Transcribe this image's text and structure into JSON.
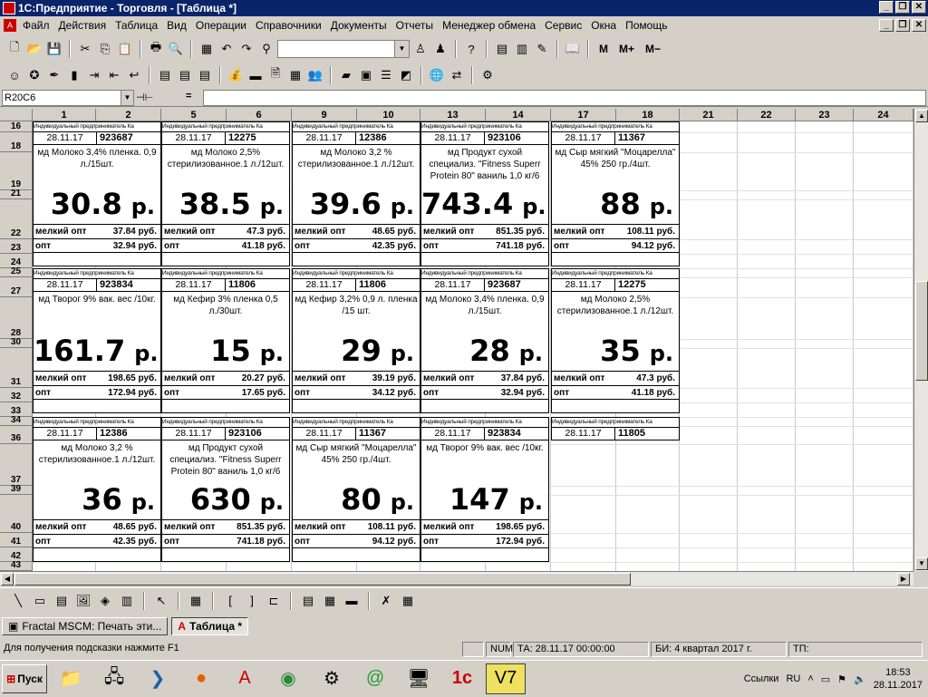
{
  "window": {
    "title": "1С:Предприятие - Торговля - [Таблица *]",
    "min": "_",
    "max": "❐",
    "close": "✕"
  },
  "menu": [
    "Файл",
    "Действия",
    "Таблица",
    "Вид",
    "Операции",
    "Справочники",
    "Документы",
    "Отчеты",
    "Менеджер обмена",
    "Сервис",
    "Окна",
    "Помощь"
  ],
  "toolbar3": {
    "m1": "M",
    "m2": "M+",
    "m3": "M−"
  },
  "formula": {
    "cellref": "R20C6",
    "eq": "="
  },
  "columns": {
    "used": [
      {
        "label": "1",
        "l": 36,
        "w": 70
      },
      {
        "label": "2",
        "l": 106,
        "w": 72
      },
      {
        "label": "5",
        "l": 178,
        "w": 72
      },
      {
        "label": "6",
        "l": 250,
        "w": 72
      },
      {
        "label": "9",
        "l": 322,
        "w": 72
      },
      {
        "label": "10",
        "l": 394,
        "w": 70
      },
      {
        "label": "13",
        "l": 464,
        "w": 72
      },
      {
        "label": "14",
        "l": 536,
        "w": 72
      },
      {
        "label": "17",
        "l": 608,
        "w": 72
      },
      {
        "label": "18",
        "l": 680,
        "w": 70
      },
      {
        "label": "21",
        "l": 750,
        "w": 64
      },
      {
        "label": "22",
        "l": 814,
        "w": 64
      },
      {
        "label": "23",
        "l": 878,
        "w": 64
      },
      {
        "label": "24",
        "l": 942,
        "w": 66
      }
    ]
  },
  "rows": [
    "16",
    "18",
    "19",
    "21",
    "22",
    "23",
    "24",
    "25",
    "27",
    "28",
    "30",
    "31",
    "32",
    "33",
    "34",
    "36",
    "37",
    "39",
    "40",
    "41",
    "42",
    "43"
  ],
  "labels": [
    {
      "header": "Индивидуальный предприниматель Ка",
      "date": "28.11.17",
      "code": "923687",
      "name": "мд Молоко  3,4% пленка. 0,9 л./15шт.",
      "price": "30.8",
      "rub": "р.",
      "opt1_k": "мелкий опт",
      "opt1_v": "37.84 руб.",
      "opt2_k": "опт",
      "opt2_v": "32.94 руб."
    },
    {
      "header": "Индивидуальный предприниматель Ка",
      "date": "28.11.17",
      "code": "12275",
      "name": "мд Молоко 2,5% стерилизованное.1 л./12шт.",
      "price": "38.5",
      "rub": "р.",
      "opt1_k": "мелкий опт",
      "opt1_v": "47.3 руб.",
      "opt2_k": "опт",
      "opt2_v": "41.18 руб."
    },
    {
      "header": "Индивидуальный предприниматель Ка",
      "date": "28.11.17",
      "code": "12386",
      "name": "мд Молоко 3,2 % стерилизованное.1 л./12шт.",
      "price": "39.6",
      "rub": "р.",
      "opt1_k": "мелкий опт",
      "opt1_v": "48.65 руб.",
      "opt2_k": "опт",
      "opt2_v": "42.35 руб."
    },
    {
      "header": "Индивидуальный предприниматель Ка",
      "date": "28.11.17",
      "code": "923106",
      "name": "мд Продукт сухой специализ. \"Fitness Superr Protein 80\" ваниль 1,0 кг/6",
      "price": "743.4",
      "rub": "р.",
      "opt1_k": "мелкий опт",
      "opt1_v": "851.35 руб.",
      "opt2_k": "опт",
      "opt2_v": "741.18 руб."
    },
    {
      "header": "Индивидуальный предприниматель Ка",
      "date": "28.11.17",
      "code": "11367",
      "name": "мд Сыр мягкий \"Моцарелла\" 45% 250 гр./4шт.",
      "price": "88",
      "rub": "р.",
      "opt1_k": "мелкий опт",
      "opt1_v": "108.11 руб.",
      "opt2_k": "опт",
      "opt2_v": "94.12 руб."
    },
    {
      "header": "Индивидуальный предприниматель Ка",
      "date": "28.11.17",
      "code": "923834",
      "name": "мд Творог 9% вак. вес /10кг.",
      "price": "161.7",
      "rub": "р.",
      "opt1_k": "мелкий опт",
      "opt1_v": "198.65 руб.",
      "opt2_k": "опт",
      "opt2_v": "172.94 руб."
    },
    {
      "header": "Индивидуальный предприниматель Ка",
      "date": "28.11.17",
      "code": "11806",
      "name": "мд Кефир 3% пленка 0,5 л./30шт.",
      "price": "15",
      "rub": "р.",
      "opt1_k": "мелкий опт",
      "opt1_v": "20.27 руб.",
      "opt2_k": "опт",
      "opt2_v": "17.65 руб."
    },
    {
      "header": "Индивидуальный предприниматель Ка",
      "date": "28.11.17",
      "code": "11806",
      "name": "мд Кефир 3,2% 0,9 л. пленка /15 шт.",
      "price": "29",
      "rub": "р.",
      "opt1_k": "мелкий опт",
      "opt1_v": "39.19 руб.",
      "opt2_k": "опт",
      "opt2_v": "34.12 руб."
    },
    {
      "header": "Индивидуальный предприниматель Ка",
      "date": "28.11.17",
      "code": "923687",
      "name": "мд Молоко  3,4% пленка. 0,9 л./15шт.",
      "price": "28",
      "rub": "р.",
      "opt1_k": "мелкий опт",
      "opt1_v": "37.84 руб.",
      "opt2_k": "опт",
      "opt2_v": "32.94 руб."
    },
    {
      "header": "Индивидуальный предприниматель Ка",
      "date": "28.11.17",
      "code": "12275",
      "name": "мд Молоко 2,5% стерилизованное.1 л./12шт.",
      "price": "35",
      "rub": "р.",
      "opt1_k": "мелкий опт",
      "opt1_v": "47.3 руб.",
      "opt2_k": "опт",
      "opt2_v": "41.18 руб."
    },
    {
      "header": "Индивидуальный предприниматель Ка",
      "date": "28.11.17",
      "code": "12386",
      "name": "мд Молоко 3,2 % стерилизованное.1 л./12шт.",
      "price": "36",
      "rub": "р.",
      "opt1_k": "мелкий опт",
      "opt1_v": "48.65 руб.",
      "opt2_k": "опт",
      "opt2_v": "42.35 руб."
    },
    {
      "header": "Индивидуальный предприниматель Ка",
      "date": "28.11.17",
      "code": "923106",
      "name": "мд Продукт сухой специализ. \"Fitness Superr Protein 80\" ваниль 1,0 кг/6",
      "price": "630",
      "rub": "р.",
      "opt1_k": "мелкий опт",
      "opt1_v": "851.35 руб.",
      "opt2_k": "опт",
      "opt2_v": "741.18 руб."
    },
    {
      "header": "Индивидуальный предприниматель Ка",
      "date": "28.11.17",
      "code": "11367",
      "name": "мд Сыр мягкий \"Моцарелла\" 45% 250 гр./4шт.",
      "price": "80",
      "rub": "р.",
      "opt1_k": "мелкий опт",
      "opt1_v": "108.11 руб.",
      "opt2_k": "опт",
      "opt2_v": "94.12 руб."
    },
    {
      "header": "Индивидуальный предприниматель Ка",
      "date": "28.11.17",
      "code": "923834",
      "name": "мд Творог 9% вак. вес /10кг.",
      "price": "147",
      "rub": "р.",
      "opt1_k": "мелкий опт",
      "opt1_v": "198.65 руб.",
      "opt2_k": "опт",
      "opt2_v": "172.94 руб."
    },
    {
      "header": "Индивидуальный предприниматель Ка",
      "date": "28.11.17",
      "code": "11805",
      "name": "",
      "price": "",
      "rub": "",
      "opt1_k": "",
      "opt1_v": "",
      "opt2_k": "",
      "opt2_v": ""
    }
  ],
  "window_tabs": [
    {
      "label": "Fractal MSCM: Печать эти..."
    },
    {
      "label": "Таблица  *"
    }
  ],
  "status": {
    "hint": "Для получения подсказки нажмите F1",
    "num": "NUM",
    "ta": "ТА: 28.11.17  00:00:00",
    "bi": "БИ: 4 квартал 2017 г.",
    "tp": "ТП:"
  },
  "taskbar": {
    "start": "Пуск",
    "links": "Ссылки",
    "lang": "RU",
    "time": "18:53",
    "date": "28.11.2017"
  }
}
